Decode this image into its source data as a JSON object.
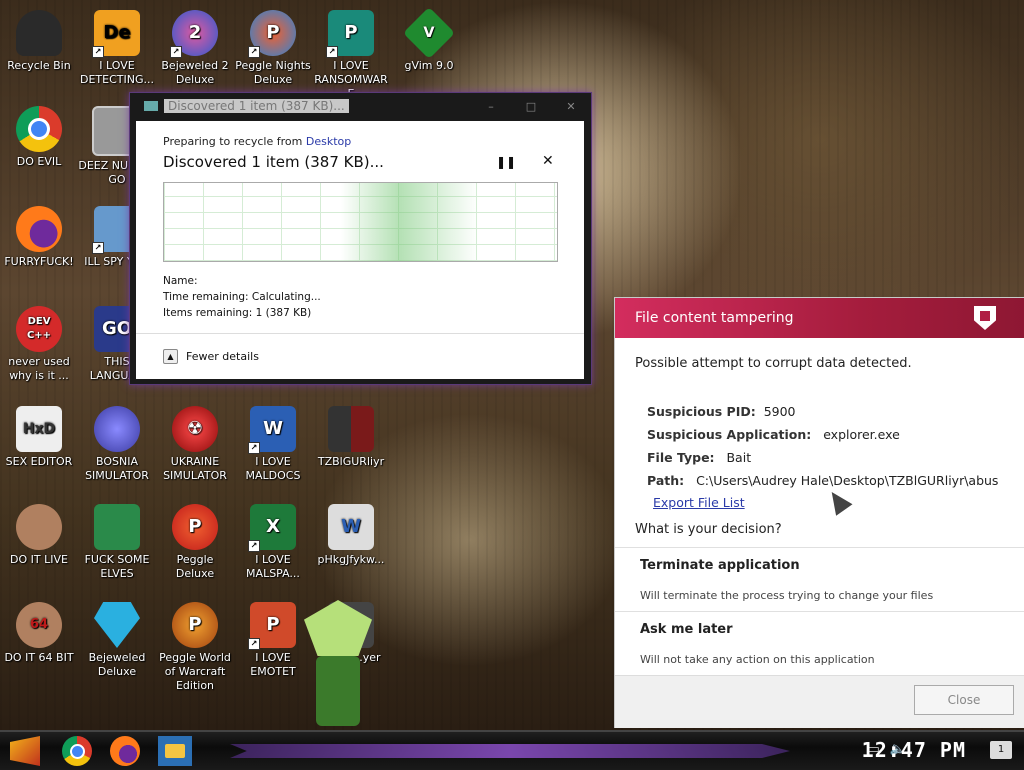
{
  "desktop": {
    "icons": [
      {
        "label": "Recycle Bin",
        "icon": "recycle-bin-icon",
        "color": "#2a2a2a"
      },
      {
        "label": "I LOVE DETECTING...",
        "icon": "detect-it-easy-icon",
        "color": "#f0a020",
        "glyph": "De"
      },
      {
        "label": "Bejeweled 2 Deluxe",
        "icon": "bejeweled-icon",
        "color": "#d43a8a",
        "glyph": "2"
      },
      {
        "label": "Peggle Nights Deluxe",
        "icon": "peggle-icon",
        "color": "#2a84d8",
        "glyph": "P"
      },
      {
        "label": "I LOVE RANSOMWARE",
        "icon": "publisher-icon",
        "color": "#1a8a7a",
        "glyph": "P"
      },
      {
        "label": "gVim 9.0",
        "icon": "vim-icon",
        "color": "#1f8a2f",
        "glyph": "V"
      },
      {
        "label": "DO EVIL",
        "icon": "chrome-icon",
        "color": "#db3b2b"
      },
      {
        "label": "DEEZ NU HAH GO",
        "icon": "window-icon",
        "color": "#888888"
      },
      {
        "label": "FURRYFUCK!",
        "icon": "firefox-icon",
        "color": "#ff7a1a"
      },
      {
        "label": "ILL SPY YOU",
        "icon": "network-icon",
        "color": "#6699cc"
      },
      {
        "label": "never used why is it ...",
        "icon": "devcpp-icon",
        "color": "#d42a2a",
        "glyph": "DEV C++"
      },
      {
        "label": "THIS LANGUAG",
        "icon": "go-icon",
        "color": "#2a3a8a",
        "glyph": "GO"
      },
      {
        "label": "SEX EDITOR",
        "icon": "hxd-icon",
        "color": "#e0e0e0",
        "glyph": "HxD"
      },
      {
        "label": "BOSNIA SIMULATOR",
        "icon": "mine-icon",
        "color": "#5a5acc"
      },
      {
        "label": "UKRAINE SIMULATOR",
        "icon": "radiation-icon",
        "color": "#c01a1a"
      },
      {
        "label": "I LOVE MALDOCS",
        "icon": "word-icon",
        "color": "#2b5fb4",
        "glyph": "W"
      },
      {
        "label": "TZBlGURliyr",
        "icon": "binary-file-icon",
        "color": "#6a2020"
      },
      {
        "label": "DO IT LIVE",
        "icon": "portrait-icon",
        "color": "#b08060"
      },
      {
        "label": "FUCK SOME ELVES",
        "icon": "santa-icon",
        "color": "#2a8a4a"
      },
      {
        "label": "Peggle Deluxe",
        "icon": "peggle-deluxe-icon",
        "color": "#e03a2a",
        "glyph": "P"
      },
      {
        "label": "I LOVE MALSPA...",
        "icon": "excel-icon",
        "color": "#1e7a3a",
        "glyph": "X"
      },
      {
        "label": "pHkgJfykw...",
        "icon": "word-doc-icon",
        "color": "#dddddd",
        "glyph": "W"
      },
      {
        "label": "DO IT 64 BIT",
        "icon": "portrait-64-icon",
        "color": "#b08060",
        "glyph": "64"
      },
      {
        "label": "Bejeweled Deluxe",
        "icon": "diamond-icon",
        "color": "#2ab0e0"
      },
      {
        "label": "Peggle World of Warcraft Edition",
        "icon": "peggle-wow-icon",
        "color": "#d0802a",
        "glyph": "P"
      },
      {
        "label": "I LOVE EMOTET",
        "icon": "powerpoint-icon",
        "color": "#d04a2a",
        "glyph": "P"
      },
      {
        "label": "...dia ...yer",
        "icon": "media-player-icon",
        "color": "#444444"
      }
    ]
  },
  "recycle_dialog": {
    "title": "Discovered 1 item (387 KB)...",
    "preparing_prefix": "Preparing to recycle from ",
    "preparing_link": "Desktop",
    "heading": "Discovered 1 item (387 KB)...",
    "pause_icon": "pause-icon",
    "name_label": "Name:",
    "time_remaining": "Time remaining: Calculating...",
    "items_remaining": "Items remaining: 1 (387 KB)",
    "fewer_details": "Fewer details",
    "minimize": "–",
    "maximize": "□",
    "close": "✕"
  },
  "tamper_panel": {
    "title": "File content tampering",
    "message": "Possible attempt to corrupt data detected.",
    "pid_label": "Suspicious PID:",
    "pid_value": "5900",
    "app_label": "Suspicious Application:",
    "app_value": "explorer.exe",
    "type_label": "File Type:",
    "type_value": "Bait",
    "path_label": "Path:",
    "path_value": "C:\\Users\\Audrey Hale\\Desktop\\TZBlGURliyr\\abus",
    "export_link": "Export File List",
    "question": "What is your decision?",
    "options": [
      {
        "title": "Terminate application",
        "desc": "Will terminate the process trying to change your files"
      },
      {
        "title": "Ask me later",
        "desc": "Will not take any action on this application"
      }
    ],
    "close_label": "Close",
    "accent_color": "#c72650"
  },
  "taskbar": {
    "apps": [
      "start-icon",
      "chrome-icon",
      "firefox-icon",
      "file-explorer-icon"
    ],
    "clock": "12:47 PM",
    "tray_icons": [
      "network-icon",
      "volume-icon"
    ],
    "notification_count": "1"
  }
}
